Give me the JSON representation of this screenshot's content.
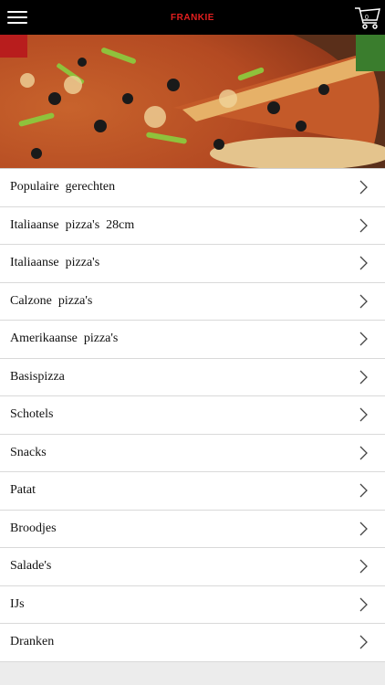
{
  "header": {
    "brand": "FRANKIE",
    "menu_icon": "hamburger-menu-icon",
    "cart_icon": "shopping-cart-icon",
    "cart_count": "0"
  },
  "hero": {
    "image": "pizza-photo"
  },
  "menu": {
    "items": [
      {
        "label": "Populaire  gerechten"
      },
      {
        "label": "Italiaanse  pizza's  28cm"
      },
      {
        "label": "Italiaanse  pizza's"
      },
      {
        "label": "Calzone  pizza's"
      },
      {
        "label": "Amerikaanse  pizza's"
      },
      {
        "label": "Basispizza"
      },
      {
        "label": "Schotels"
      },
      {
        "label": "Snacks"
      },
      {
        "label": "Patat"
      },
      {
        "label": "Broodjes"
      },
      {
        "label": "Salade's"
      },
      {
        "label": "IJs"
      },
      {
        "label": "Dranken"
      }
    ],
    "chevron_icon": "chevron-right-icon"
  },
  "colors": {
    "topbar": "#000000",
    "brand": "#e41f1f",
    "background": "#ececec"
  }
}
